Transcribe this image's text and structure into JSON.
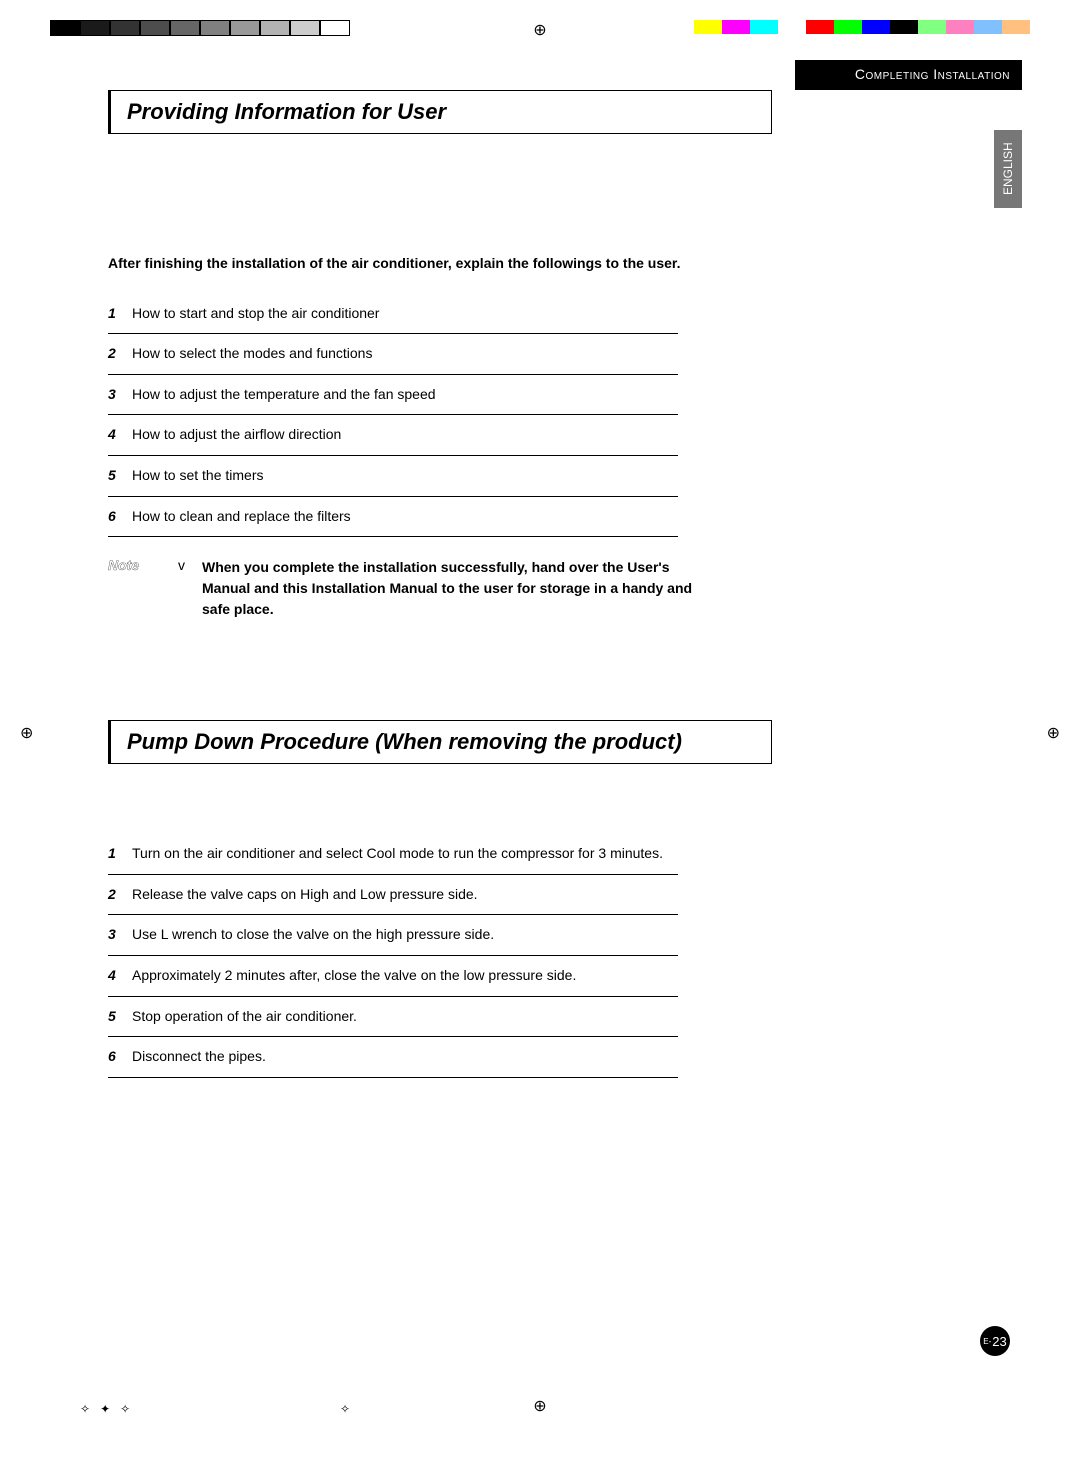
{
  "print": {
    "grays": [
      "#000000",
      "#1a1a1a",
      "#333333",
      "#4d4d4d",
      "#666666",
      "#808080",
      "#999999",
      "#b3b3b3",
      "#cccccc",
      "#ffffff"
    ],
    "colors": [
      "#ffff00",
      "#ff00ff",
      "#00ffff",
      "#ffffff",
      "#ff0000",
      "#00ff00",
      "#0000ff",
      "#000000",
      "#80ff80",
      "#ff80c0",
      "#80c0ff",
      "#ffc080"
    ]
  },
  "header": {
    "section_label": "Completing Installation",
    "language": "ENGLISH"
  },
  "section1": {
    "title": "Providing Information for User",
    "intro": "After finishing the installation of the air conditioner, explain the followings to the user.",
    "steps": [
      "How to start and stop the air conditioner",
      "How to select the modes and functions",
      "How to adjust the temperature and the fan speed",
      "How to adjust the airflow direction",
      "How to set the timers",
      "How to clean and replace the filters"
    ],
    "note_label": "Note",
    "note_text": "When you complete the installation successfully, hand over the User's Manual and this Installation Manual to the user for storage in a handy and safe place."
  },
  "section2": {
    "title": "Pump Down Procedure (When removing the product)",
    "steps": [
      "Turn on the air conditioner and select Cool mode to run the compressor for 3 minutes.",
      "Release the valve caps on High and Low pressure side.",
      "Use L wrench to close the valve on the high pressure side.",
      "Approximately 2 minutes after, close the valve on the low pressure side.",
      "Stop operation of the air conditioner.",
      "Disconnect the pipes."
    ]
  },
  "page": {
    "prefix": "E-",
    "number": "23"
  }
}
